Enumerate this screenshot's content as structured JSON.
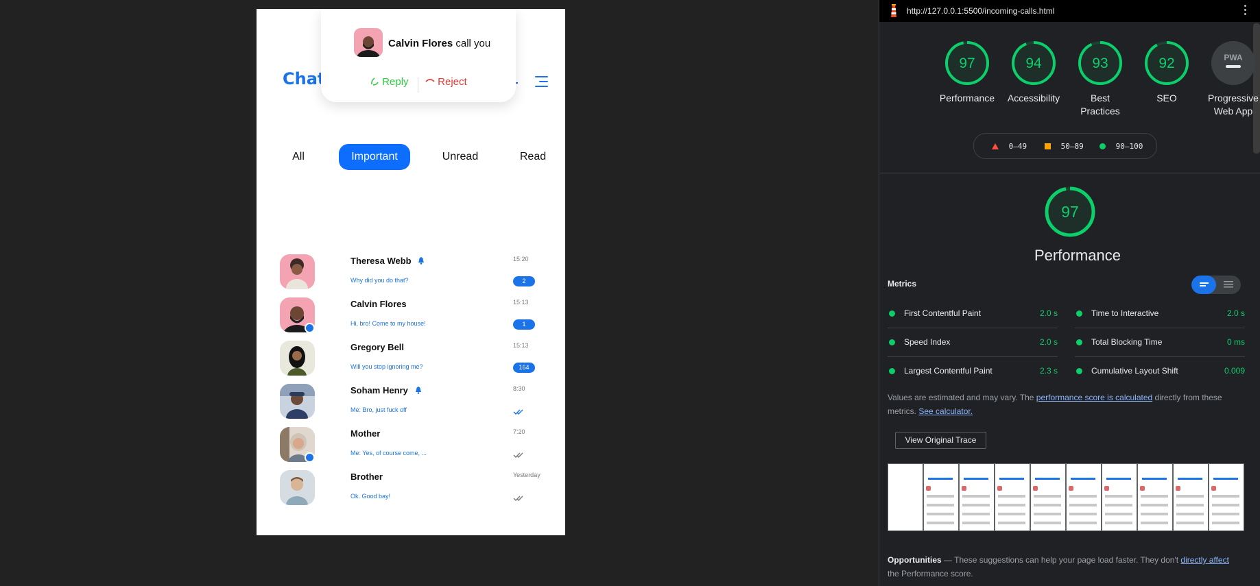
{
  "phone": {
    "title": "Chati",
    "call_popup": {
      "caller": "Calvin Flores",
      "suffix": " call you",
      "reply_label": "Reply",
      "reject_label": "Reject"
    },
    "tabs": [
      {
        "label": "All",
        "active": false
      },
      {
        "label": "Important",
        "active": true
      },
      {
        "label": "Unread",
        "active": false
      },
      {
        "label": "Read",
        "active": false
      }
    ],
    "chats": [
      {
        "name": "Theresa Webb",
        "message": "Why did you do that?",
        "time": "15:20",
        "badge": "2",
        "bell": true,
        "online": false,
        "status_icon": "none",
        "avatar_color": "#f4a3b2"
      },
      {
        "name": "Calvin Flores",
        "message": "Hi, bro! Come to my house!",
        "time": "15:13",
        "badge": "1",
        "bell": false,
        "online": true,
        "status_icon": "none",
        "avatar_color": "#f4a3b2"
      },
      {
        "name": "Gregory Bell",
        "message": "Will you stop ignoring me?",
        "time": "15:13",
        "badge": "164",
        "bell": false,
        "online": false,
        "status_icon": "none",
        "avatar_color": "#d9d9c8"
      },
      {
        "name": "Soham Henry",
        "message": "Me: Bro, just fuck off",
        "time": "8:30",
        "badge": "",
        "bell": true,
        "online": false,
        "status_icon": "double-check-blue",
        "avatar_color": "#c9d3e0"
      },
      {
        "name": "Mother",
        "message": "Me: Yes, of course come, ...",
        "time": "7:20",
        "badge": "",
        "bell": false,
        "online": true,
        "status_icon": "double-check-grey",
        "avatar_color": "#d8cfc4"
      },
      {
        "name": "Brother",
        "message": "Ok. Good bay!",
        "time": "Yesterday",
        "badge": "",
        "bell": false,
        "online": false,
        "status_icon": "double-check-grey",
        "avatar_color": "#d0d8dd"
      }
    ]
  },
  "lighthouse": {
    "url": "http://127.0.0.1:5500/incoming-calls.html",
    "scores": [
      {
        "label": "Performance",
        "score": 97
      },
      {
        "label": "Accessibility",
        "score": 94
      },
      {
        "label": "Best Practices",
        "score": 93
      },
      {
        "label": "SEO",
        "score": 92
      }
    ],
    "pwa": {
      "label": "Progressive Web App",
      "badge": "PWA"
    },
    "legend": {
      "fail": "0–49",
      "average": "50–89",
      "pass": "90–100"
    },
    "perf_title": "Performance",
    "perf_score": 97,
    "metrics_title": "Metrics",
    "metrics": [
      {
        "name": "First Contentful Paint",
        "value": "2.0 s"
      },
      {
        "name": "Time to Interactive",
        "value": "2.0 s"
      },
      {
        "name": "Speed Index",
        "value": "2.0 s"
      },
      {
        "name": "Total Blocking Time",
        "value": "0 ms"
      },
      {
        "name": "Largest Contentful Paint",
        "value": "2.3 s"
      },
      {
        "name": "Cumulative Layout Shift",
        "value": "0.009"
      }
    ],
    "note": {
      "pre": "Values are estimated and may vary. The ",
      "link1": "performance score is calculated",
      "mid": " directly from these metrics. ",
      "link2": "See calculator."
    },
    "trace_button": "View Original Trace",
    "opportunities": {
      "title": "Opportunities",
      "text": " — These suggestions can help your page load faster. They don't ",
      "link": "directly affect",
      "tail": " the Performance score."
    },
    "colors": {
      "pass": "#0cce6b",
      "average": "#ffa400",
      "fail": "#ff4e42",
      "accent": "#1a73e8"
    }
  }
}
